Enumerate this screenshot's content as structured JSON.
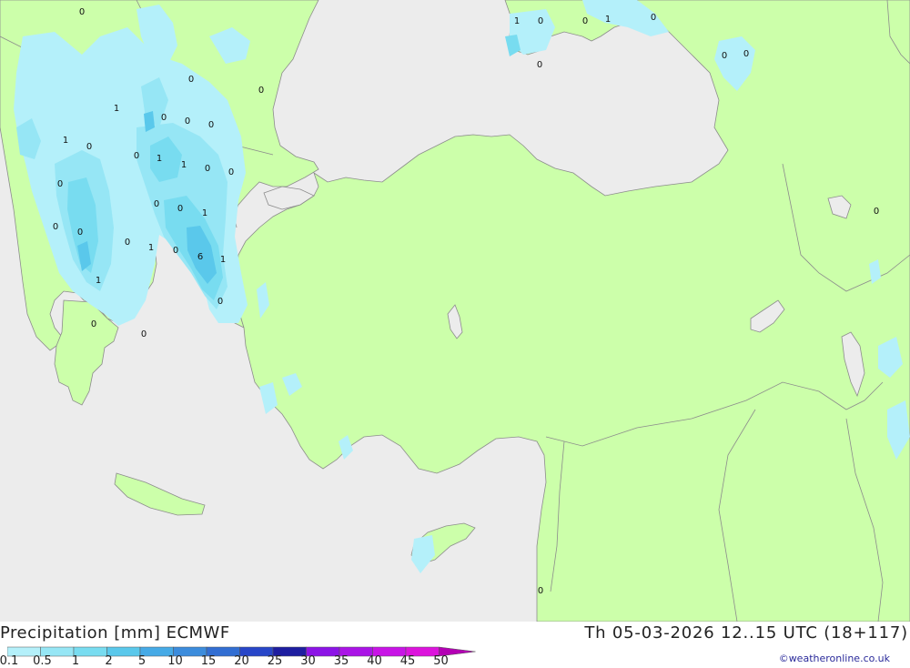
{
  "header": {
    "title": "Precipitation [mm] ECMWF",
    "valid_time": "Th 05-03-2026 12..15 UTC (18+117)",
    "credit": "©weatheronline.co.uk"
  },
  "colors": {
    "sea": "#ececec",
    "land": "#ccffaa",
    "border": "#8c8c8c"
  },
  "legend": {
    "labels": [
      "0.1",
      "0.5",
      "1",
      "2",
      "5",
      "10",
      "15",
      "20",
      "25",
      "30",
      "35",
      "40",
      "45",
      "50"
    ],
    "colors": [
      "#b4f0fa",
      "#96e6f5",
      "#78dcf0",
      "#5ac8eb",
      "#46aae6",
      "#3c8cdc",
      "#326ed2",
      "#2846c8",
      "#1e1ea0",
      "#8c14e6",
      "#aa14e6",
      "#c814e6",
      "#dc14dc",
      "#b400b4"
    ]
  },
  "map_labels": [
    {
      "text": "0"
    },
    {
      "text": "1"
    },
    {
      "text": "0"
    },
    {
      "text": "0"
    },
    {
      "text": "1"
    },
    {
      "text": "0"
    },
    {
      "text": "0"
    },
    {
      "text": "0"
    },
    {
      "text": "0"
    },
    {
      "text": "0"
    },
    {
      "text": "0"
    },
    {
      "text": "1"
    },
    {
      "text": "0"
    },
    {
      "text": "0"
    },
    {
      "text": "0"
    },
    {
      "text": "1"
    },
    {
      "text": "0"
    },
    {
      "text": "1"
    },
    {
      "text": "1"
    },
    {
      "text": "0"
    },
    {
      "text": "0"
    },
    {
      "text": "0"
    },
    {
      "text": "1"
    },
    {
      "text": "0"
    },
    {
      "text": "0"
    },
    {
      "text": "0"
    },
    {
      "text": "1"
    },
    {
      "text": "0"
    },
    {
      "text": "6"
    },
    {
      "text": "1"
    },
    {
      "text": "1"
    },
    {
      "text": "0"
    },
    {
      "text": "0"
    },
    {
      "text": "0"
    },
    {
      "text": "0"
    },
    {
      "text": "0"
    }
  ]
}
